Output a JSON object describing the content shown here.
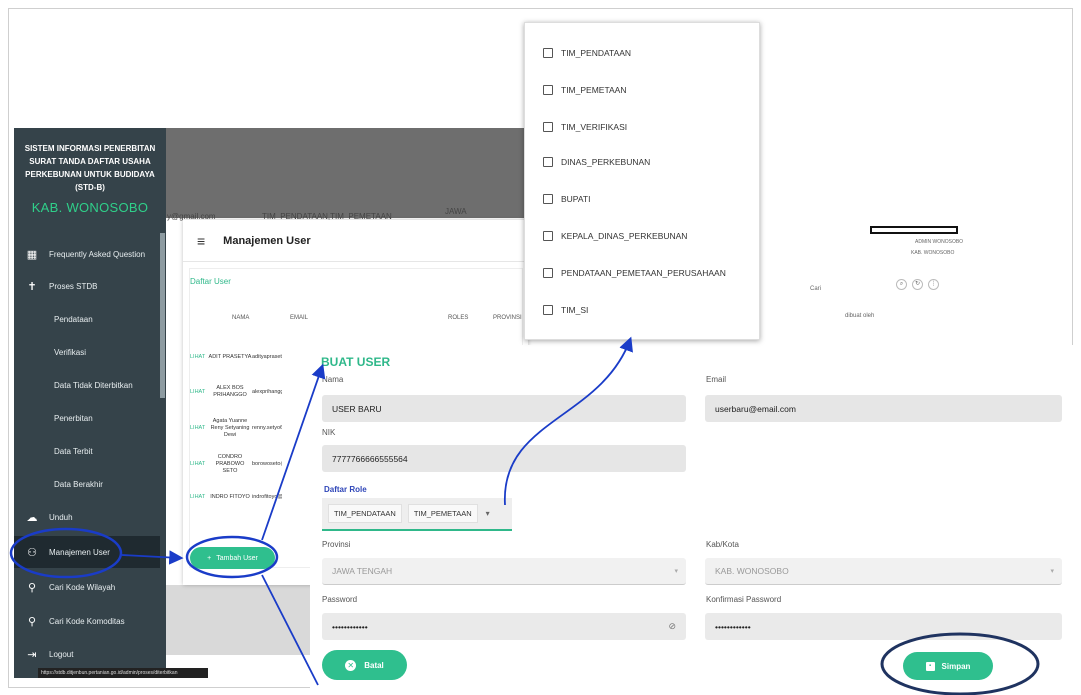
{
  "sidebar": {
    "title": "SISTEM INFORMASI PENERBITAN SURAT TANDA DAFTAR USAHA PERKEBUNAN UNTUK BUDIDAYA (STD-B)",
    "subtitle": "KAB. WONOSOBO",
    "items": [
      {
        "label": "Frequently Asked Question",
        "icon": "faq-icon"
      },
      {
        "label": "Proses STDB",
        "icon": "person-icon"
      },
      {
        "label": "Pendataan"
      },
      {
        "label": "Verifikasi"
      },
      {
        "label": "Data Tidak Diterbitkan"
      },
      {
        "label": "Penerbitan"
      },
      {
        "label": "Data Terbit"
      },
      {
        "label": "Data Berakhir"
      },
      {
        "label": "Unduh",
        "icon": "cloud-download-icon"
      },
      {
        "label": "Manajemen User",
        "icon": "user-manage-icon"
      },
      {
        "label": "Cari Kode Wilayah",
        "icon": "search-icon"
      },
      {
        "label": "Cari Kode Komoditas",
        "icon": "search-icon"
      },
      {
        "label": "Logout",
        "icon": "logout-icon"
      }
    ],
    "status_url": "https://stdb.ditjenbun.pertanian.go.id/admin/proses/diterbitkan"
  },
  "background": {
    "email_fragment": "y@gmail.com",
    "roles_fragment": "TIM_PENDATAAN,TIM_PEMETAAN",
    "province_fragment": "JAWA",
    "user_name": "ADMIN WONOSOBO",
    "user_region": "KAB. WONOSOBO",
    "search_placeholder": "Cari",
    "col_dibuat": "dibuat oleh"
  },
  "manajemen_user": {
    "title": "Manajemen User",
    "daftar_label": "Daftar User",
    "columns": [
      "NAMA",
      "EMAIL",
      "ROLES",
      "PROVINSI"
    ],
    "rows": [
      {
        "link": "LIHAT",
        "name": "ADIT PRASETYA",
        "email": "adityaprasetya@"
      },
      {
        "link": "LIHAT",
        "name": "ALEX BOS PRIHANGGO",
        "email": "alexprihanggo@"
      },
      {
        "link": "LIHAT",
        "name": "Agata Yuanne Reny Setyaning Dewi",
        "email": "renny.setyo61@"
      },
      {
        "link": "LIHAT",
        "name": "CONDRO PRABOWO SETO",
        "email": "borowoseto@"
      },
      {
        "link": "LIHAT",
        "name": "INDRO FITOYO",
        "email": "indrofitoyo@"
      }
    ],
    "tambah_button": "Tambah User"
  },
  "form": {
    "title": "BUAT USER",
    "nama_label": "Nama",
    "nama_value": "USER BARU",
    "email_label": "Email",
    "email_value": "userbaru@email.com",
    "nik_label": "NIK",
    "nik_value": "7777766666555564",
    "role_label": "Daftar Role",
    "roles_selected": [
      "TIM_PENDATAAN",
      "TIM_PEMETAAN"
    ],
    "provinsi_label": "Provinsi",
    "provinsi_value": "JAWA TENGAH",
    "kabkota_label": "Kab/Kota",
    "kabkota_value": "KAB. WONOSOBO",
    "password_label": "Password",
    "password_value": "••••••••••••",
    "konfirmasi_label": "Konfirmasi Password",
    "konfirmasi_value": "••••••••••••",
    "batal_button": "Batal",
    "simpan_button": "Simpan"
  },
  "role_dropdown": {
    "options": [
      "TIM_PENDATAAN",
      "TIM_PEMETAAN",
      "TIM_VERIFIKASI",
      "DINAS_PERKEBUNAN",
      "BUPATI",
      "KEPALA_DINAS_PERKEBUNAN",
      "PENDATAAN_PEMETAAN_PERUSAHAAN",
      "TIM_SI"
    ]
  },
  "colors": {
    "accent": "#2fbf8e",
    "sidebar": "#35434a",
    "annotation": "#1a3cc8"
  }
}
